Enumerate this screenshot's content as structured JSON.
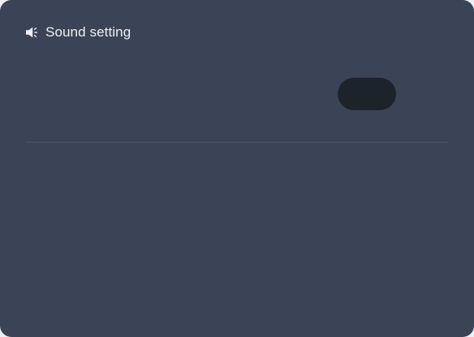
{
  "header": {
    "icon": "speaker-icon",
    "title": "Sound setting"
  },
  "sound_toggle": {
    "state": "off"
  },
  "colors": {
    "panel_background": "#3a4456",
    "toggle_background": "#1d232b",
    "divider": "#4c576b",
    "title_text": "#eef1f6"
  }
}
